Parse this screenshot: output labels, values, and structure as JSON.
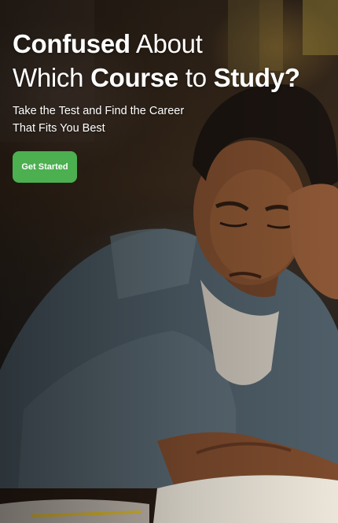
{
  "hero": {
    "headline": {
      "line1_bold": "Confused",
      "line1_rest": " About",
      "line2_start": "Which ",
      "line2_bold1": "Course",
      "line2_mid": " to ",
      "line2_bold2": "Study?"
    },
    "subtitle": {
      "line1": "Take the Test and Find the Career",
      "line2": "That Fits You Best"
    },
    "cta_label": "Get Started"
  },
  "colors": {
    "cta_background": "#4caf50",
    "text": "#ffffff"
  }
}
